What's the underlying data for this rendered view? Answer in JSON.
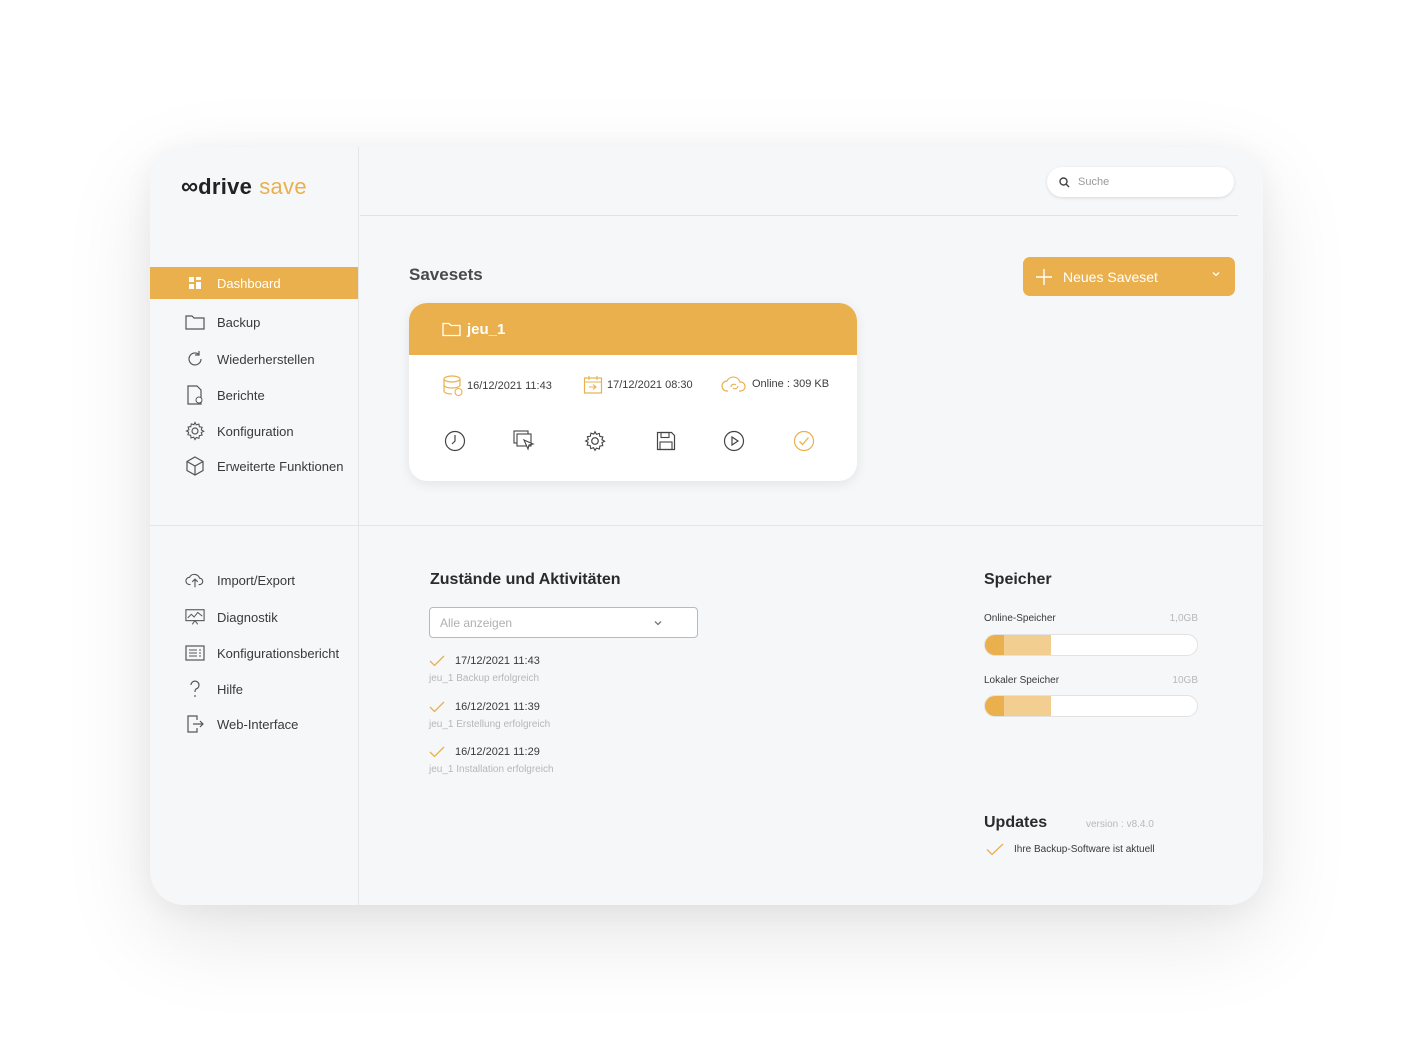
{
  "brand": {
    "logo_mark": "∞",
    "name_bold": "drive",
    "name_accent": "save",
    "accent_color": "#e9b04d"
  },
  "search": {
    "placeholder": "Suche",
    "icon": "search-icon"
  },
  "sidebar": {
    "main_items": [
      {
        "label": "Dashboard",
        "icon": "dashboard-icon",
        "active": true
      },
      {
        "label": "Backup",
        "icon": "folder-icon"
      },
      {
        "label": "Wiederherstellen",
        "icon": "restore-icon"
      },
      {
        "label": "Berichte",
        "icon": "report-icon"
      },
      {
        "label": "Konfiguration",
        "icon": "gear-icon"
      },
      {
        "label": "Erweiterte Funktionen",
        "icon": "cube-icon"
      }
    ],
    "secondary_items": [
      {
        "label": "Import/Export",
        "icon": "cloud-upload-icon"
      },
      {
        "label": "Diagnostik",
        "icon": "monitor-chart-icon"
      },
      {
        "label": "Konfigurationsbericht",
        "icon": "list-document-icon"
      },
      {
        "label": "Hilfe",
        "icon": "question-icon"
      },
      {
        "label": "Web-Interface",
        "icon": "exit-icon"
      }
    ]
  },
  "savesets": {
    "title": "Savesets",
    "new_button": "Neues Saveset",
    "card": {
      "name": "jeu_1",
      "last_backup": "16/12/2021 11:43",
      "next_backup": "17/12/2021 08:30",
      "online": "Online : 309 KB",
      "actions": [
        "clock-icon",
        "select-files-icon",
        "gear-icon",
        "save-icon",
        "play-icon",
        "check-circle-icon"
      ]
    }
  },
  "activities": {
    "title": "Zustände und Aktivitäten",
    "filter": "Alle anzeigen",
    "items": [
      {
        "time": "17/12/2021 11:43",
        "desc": "jeu_1 Backup erfolgreich"
      },
      {
        "time": "16/12/2021 11:39",
        "desc": "jeu_1 Erstellung erfolgreich"
      },
      {
        "time": "16/12/2021 11:29",
        "desc": "jeu_1 Installation erfolgreich"
      }
    ]
  },
  "storage": {
    "title": "Speicher",
    "online": {
      "label": "Online-Speicher",
      "max": "1,0GB",
      "used_fraction": 0.09,
      "reserved_fraction": 0.31
    },
    "local": {
      "label": "Lokaler Speicher",
      "max": "10GB",
      "used_fraction": 0.09,
      "reserved_fraction": 0.31
    }
  },
  "updates": {
    "title": "Updates",
    "version": "version : v8.4.0",
    "status": "Ihre Backup-Software ist aktuell"
  }
}
